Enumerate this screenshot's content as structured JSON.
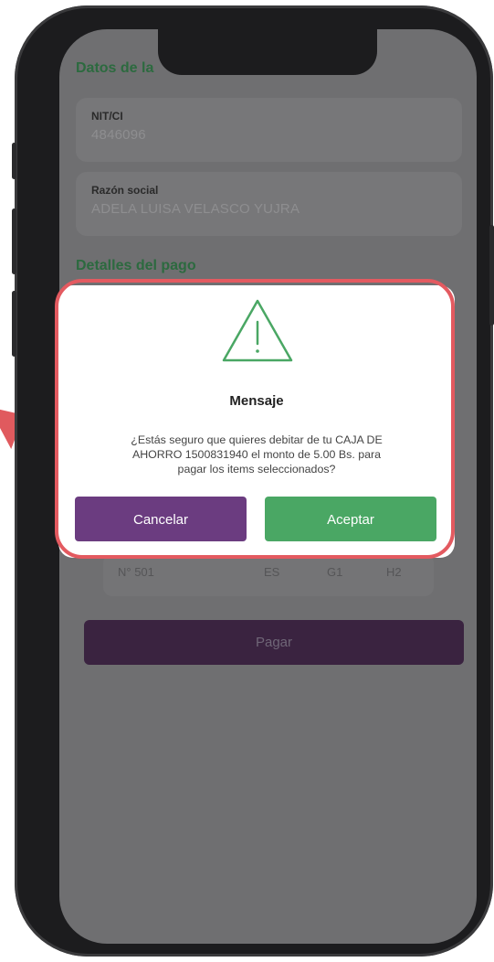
{
  "background": {
    "billing_section_title": "Datos de la",
    "nit": {
      "label": "NIT/CI",
      "value": "4846096"
    },
    "razon_social": {
      "label": "Razón social",
      "value": "ADELA LUISA  VELASCO YUJRA"
    },
    "payment_section_title": "Detalles del pago",
    "row": {
      "number": "N° 501",
      "col1": "ES",
      "col2": "G1",
      "col3": "H2"
    },
    "pay_button": "Pagar"
  },
  "dialog": {
    "icon": "warning-triangle-icon",
    "title": "Mensaje",
    "message_line1": "¿Estás seguro que quieres debitar de tu CAJA DE",
    "message_line2": "AHORRO 1500831940 el monto de 5.00 Bs. para",
    "message_line3": "pagar los items seleccionados?",
    "cancel_label": "Cancelar",
    "accept_label": "Aceptar"
  },
  "colors": {
    "highlight": "#e35a60",
    "cancel": "#6b3c80",
    "accept": "#4aa764",
    "icon": "#4aa764",
    "section_title": "#2c6a3f"
  }
}
